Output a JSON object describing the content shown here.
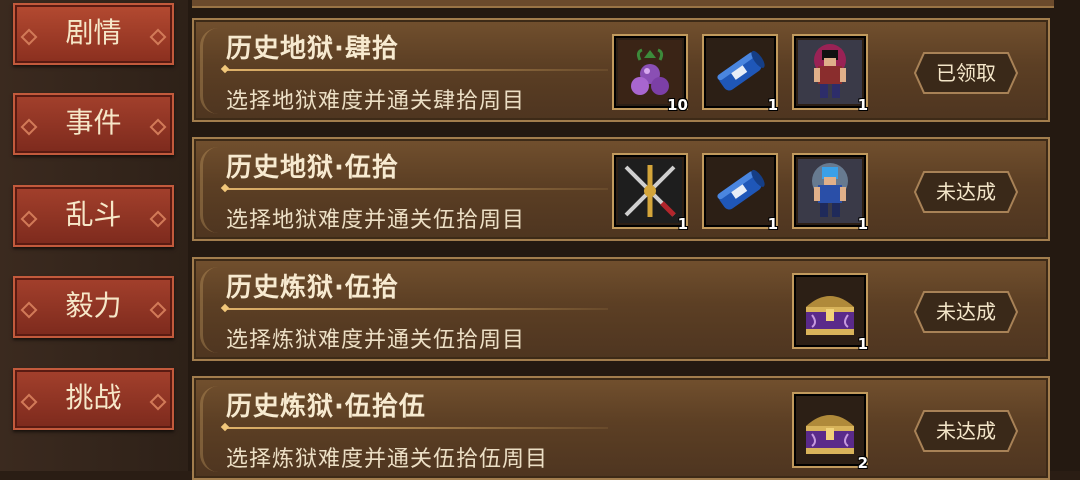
{
  "sidebar": {
    "tabs": [
      {
        "label": "剧情"
      },
      {
        "label": "事件"
      },
      {
        "label": "乱斗"
      },
      {
        "label": "毅力"
      },
      {
        "label": "挑战"
      }
    ]
  },
  "missions": [
    {
      "title": "历史地狱·肆拾",
      "description": "选择地狱难度并通关肆拾周目",
      "status": "已领取",
      "rewards": [
        {
          "icon": "purple-fruit-icon",
          "qty": "10"
        },
        {
          "icon": "blue-scroll-icon",
          "qty": "1"
        },
        {
          "icon": "pixel-warrior-red-icon",
          "qty": "1"
        }
      ]
    },
    {
      "title": "历史地狱·伍拾",
      "description": "选择地狱难度并通关伍拾周目",
      "status": "未达成",
      "rewards": [
        {
          "icon": "crossed-weapons-icon",
          "qty": "1"
        },
        {
          "icon": "blue-scroll-icon",
          "qty": "1"
        },
        {
          "icon": "pixel-warrior-blue-icon",
          "qty": "1"
        }
      ]
    },
    {
      "title": "历史炼狱·伍拾",
      "description": "选择炼狱难度并通关伍拾周目",
      "status": "未达成",
      "rewards": [
        {
          "icon": "treasure-chest-icon",
          "qty": "1"
        }
      ]
    },
    {
      "title": "历史炼狱·伍拾伍",
      "description": "选择炼狱难度并通关伍拾伍周目",
      "status": "未达成",
      "rewards": [
        {
          "icon": "treasure-chest-icon",
          "qty": "2"
        }
      ]
    }
  ]
}
